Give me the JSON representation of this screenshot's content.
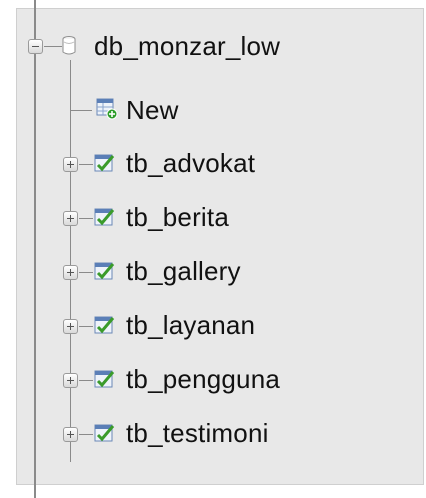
{
  "database": {
    "name": "db_monzar_low"
  },
  "new_item": {
    "label": "New"
  },
  "tables": [
    {
      "name": "tb_advokat"
    },
    {
      "name": "tb_berita"
    },
    {
      "name": "tb_gallery"
    },
    {
      "name": "tb_layanan"
    },
    {
      "name": "tb_pengguna"
    },
    {
      "name": "tb_testimoni"
    }
  ],
  "icons": {
    "database": "database-icon",
    "new": "new-table-icon",
    "table": "table-structure-icon",
    "collapse": "collapse-icon",
    "expand": "expand-icon"
  },
  "colors": {
    "panel_bg": "#e8e8e8",
    "tree_line": "#8a8a8a",
    "text": "#111111",
    "check_green": "#3a9b2b",
    "table_blue": "#4f7fbf"
  }
}
